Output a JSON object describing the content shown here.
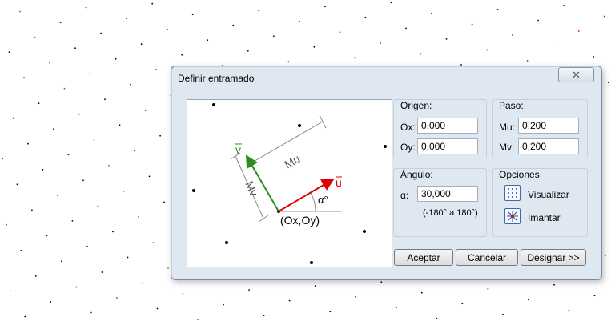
{
  "dialog": {
    "title": "Definir entramado",
    "close_glyph": "✕"
  },
  "diagram": {
    "v_label": "v",
    "u_label": "u",
    "mu_label": "Mu",
    "mv_label": "Mv",
    "alpha_label": "α°",
    "origin_label": "(Ox,Oy)",
    "u_color": "#e00000",
    "v_color": "#2e8b1f"
  },
  "origen": {
    "label": "Origen:",
    "ox_label": "Ox:",
    "ox_value": "0,000",
    "oy_label": "Oy:",
    "oy_value": "0,000"
  },
  "paso": {
    "label": "Paso:",
    "mu_label": "Mu:",
    "mu_value": "0,200",
    "mv_label": "Mv:",
    "mv_value": "0,200"
  },
  "angulo": {
    "label": "Ángulo:",
    "alpha_label": "α:",
    "alpha_value": "30,000",
    "range_hint": "(-180° a 180°)"
  },
  "opciones": {
    "label": "Opciones",
    "visualizar": "Visualizar",
    "imantar": "Imantar",
    "icon_visualizar": "grid-dots-icon",
    "icon_imantar": "snap-magnet-icon"
  },
  "buttons": {
    "aceptar": "Aceptar",
    "cancelar": "Cancelar",
    "designar": "Designar >>"
  },
  "colors": {
    "dialog_bg": "#dfe7f1",
    "grid_dot_green": "#19a019",
    "grid_dot_red": "#d01010",
    "grid_dot_black": "#000000"
  }
}
